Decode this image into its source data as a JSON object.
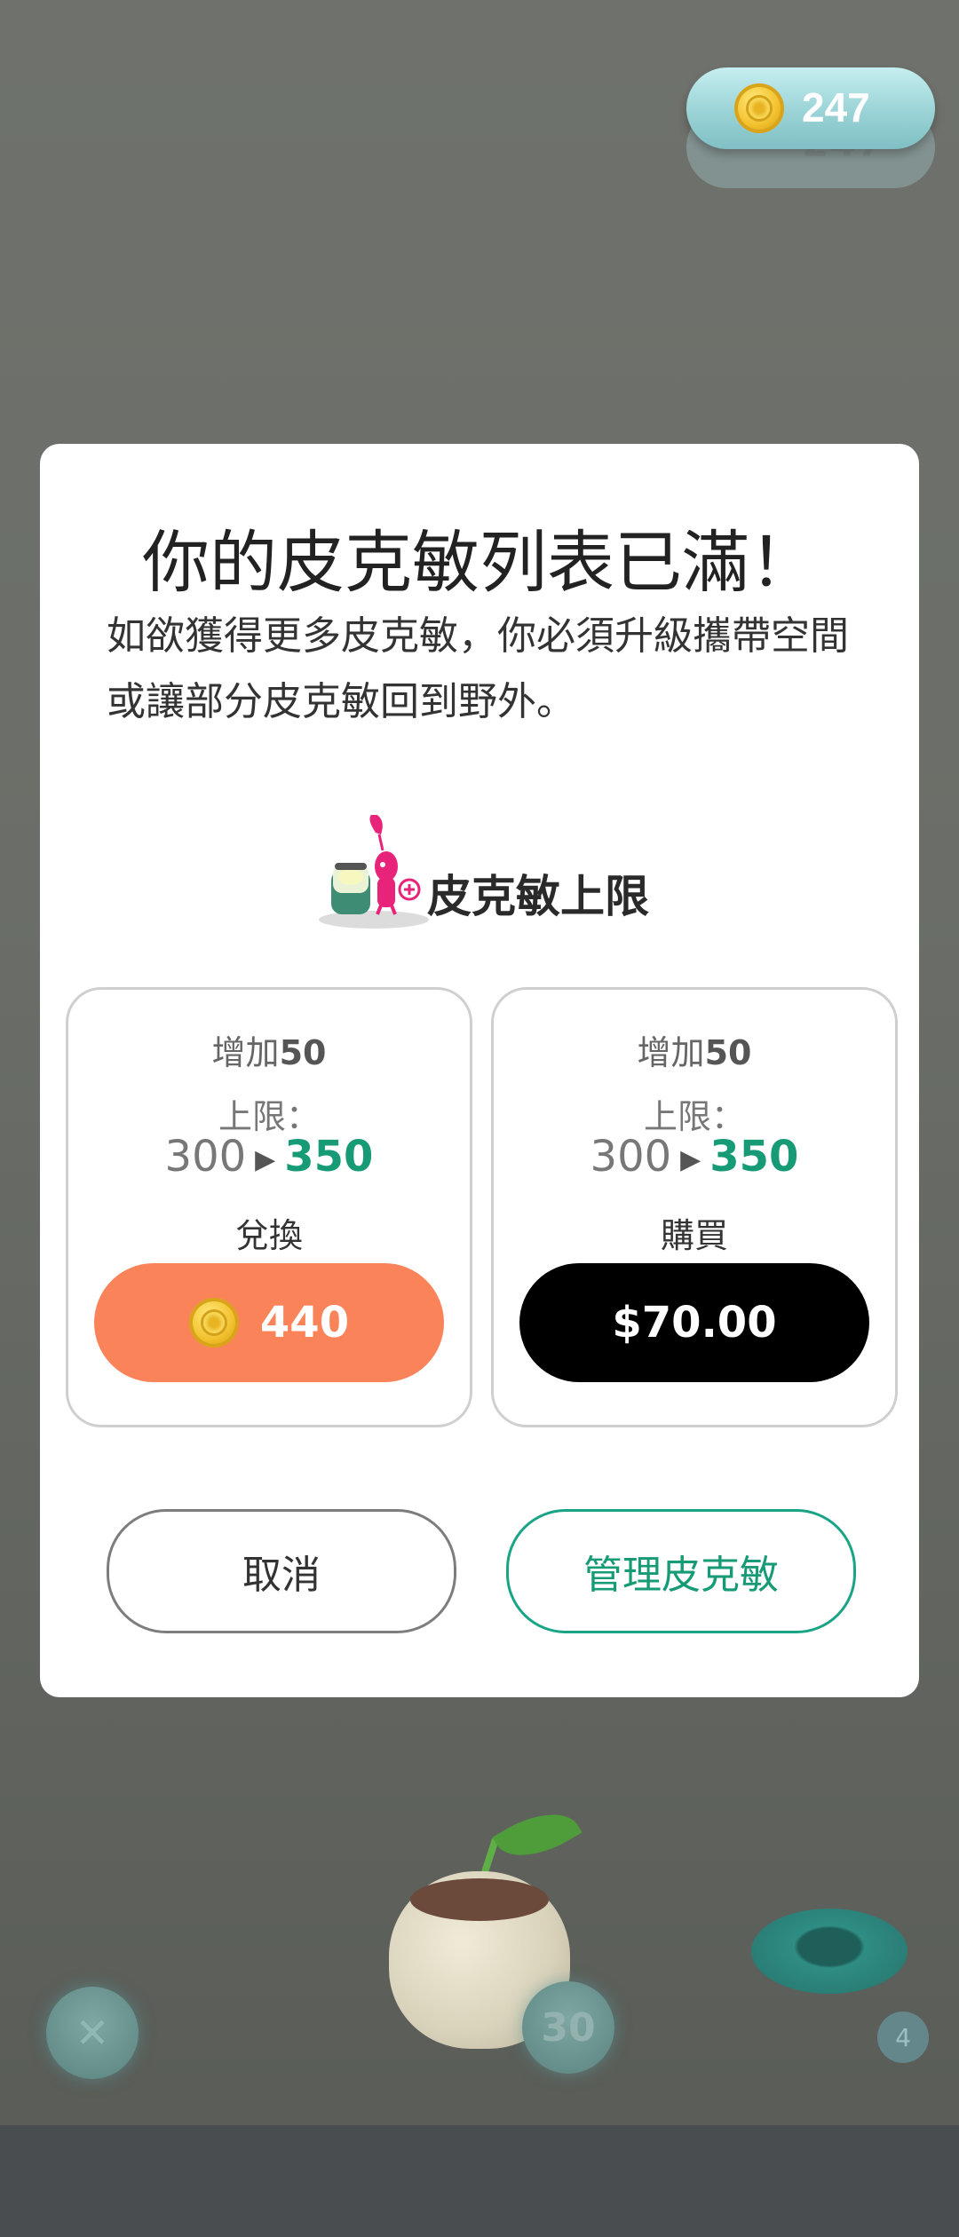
{
  "coin_counter": {
    "value": "247",
    "icon": "coin-icon"
  },
  "background": {
    "close_icon": "close-icon",
    "close_glyph": "✕",
    "count": "30",
    "badge": "4"
  },
  "dialog": {
    "title": "你的皮克敏列表已滿！",
    "message": "如欲獲得更多皮克敏，你必須升級攜帶空間或讓部分皮克敏回到野外。",
    "limit_label": "皮克敏上限",
    "options": [
      {
        "increase_prefix": "增加",
        "increase_amount": "50",
        "limit_label": "上限：",
        "from": "300",
        "to": "350",
        "action_label": "兌換",
        "button_value": "440",
        "button_icon": "coin-icon"
      },
      {
        "increase_prefix": "增加",
        "increase_amount": "50",
        "limit_label": "上限：",
        "from": "300",
        "to": "350",
        "action_label": "購買",
        "button_value": "$70.00"
      }
    ],
    "cancel_label": "取消",
    "manage_label": "管理皮克敏"
  },
  "colors": {
    "exchange_button": "#fb8359",
    "purchase_button": "#000000",
    "accent_green": "#179a76"
  }
}
